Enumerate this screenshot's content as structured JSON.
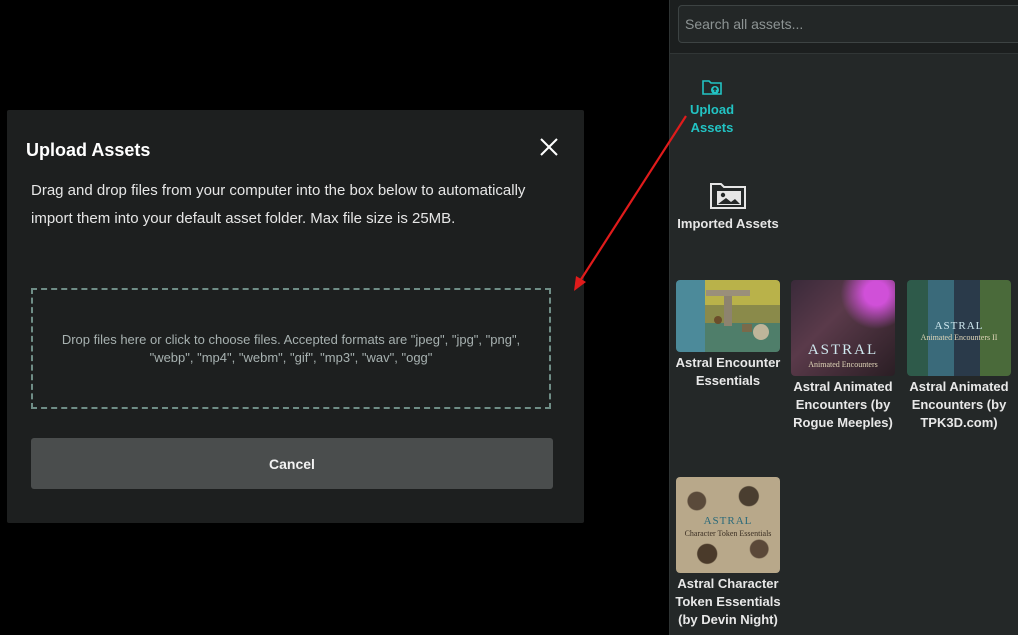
{
  "modal": {
    "title": "Upload Assets",
    "description": "Drag and drop files from your computer into the box below to automatically import them into your default asset folder. Max file size is 25MB.",
    "dropzone_text": "Drop files here or click to choose files. Accepted formats are \"jpeg\", \"jpg\", \"png\", \"webp\", \"mp4\", \"webm\", \"gif\", \"mp3\", \"wav\", \"ogg\"",
    "cancel_label": "Cancel",
    "close_icon": "close-icon"
  },
  "panel": {
    "search": {
      "placeholder": "Search all assets..."
    },
    "folders": [
      {
        "label": "Upload\nAssets",
        "icon": "upload-folder-icon",
        "color": "#22c3c3"
      },
      {
        "label": "Imported Assets",
        "icon": "image-folder-icon"
      }
    ],
    "assets": [
      {
        "label": "Astral Encounter Essentials",
        "thumb_text": ""
      },
      {
        "label": "Astral Animated Encounters (by Rogue Meeples)",
        "thumb_text": "ASTRAL",
        "thumb_subtext": "Animated Encounters"
      },
      {
        "label": "Astral Animated Encounters (by TPK3D.com)",
        "thumb_text": "ASTRAL",
        "thumb_subtext": "Animated Encounters II"
      },
      {
        "label": "Astral Character Token Essentials (by Devin Night)",
        "thumb_text": "ASTRAL",
        "thumb_subtext": "Character Token Essentials"
      }
    ]
  },
  "colors": {
    "accent": "#22c3c3",
    "arrow": "#e01b1b",
    "modal_bg": "#1d1f1f",
    "panel_bg": "#242828"
  }
}
